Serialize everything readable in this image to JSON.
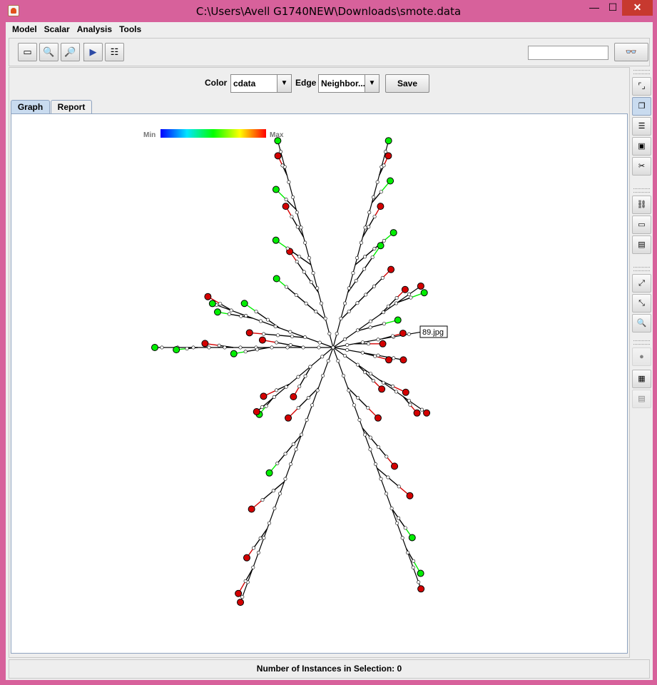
{
  "window": {
    "title": "C:\\Users\\Avell G1740NEW\\Downloads\\smote.data",
    "minimize": "—",
    "maximize": "☐",
    "close": "✕"
  },
  "menu": [
    "Model",
    "Scalar",
    "Analysis",
    "Tools"
  ],
  "toolbar": {
    "search_value": "",
    "icons": [
      "open-icon",
      "zoom-in-icon",
      "zoom-out-icon",
      "play-icon",
      "list-icon",
      "binoculars-icon"
    ]
  },
  "controls": {
    "color_label": "Color",
    "color_value": "cdata",
    "edge_label": "Edge",
    "edge_value": "Neighbor...",
    "save_label": "Save"
  },
  "tabs": [
    {
      "label": "Graph",
      "active": true
    },
    {
      "label": "Report",
      "active": false
    }
  ],
  "legend": {
    "min_label": "Min",
    "max_label": "Max",
    "colors": [
      "#0000ff",
      "#00e5ff",
      "#00ff00",
      "#ffff00",
      "#ff0000"
    ]
  },
  "tooltip_label": "89.jpg",
  "node_colors": {
    "green": "#00ee00",
    "red": "#d40000",
    "internal": "#ffffff"
  },
  "status": {
    "text": "Number of Instances in Selection: 0"
  }
}
